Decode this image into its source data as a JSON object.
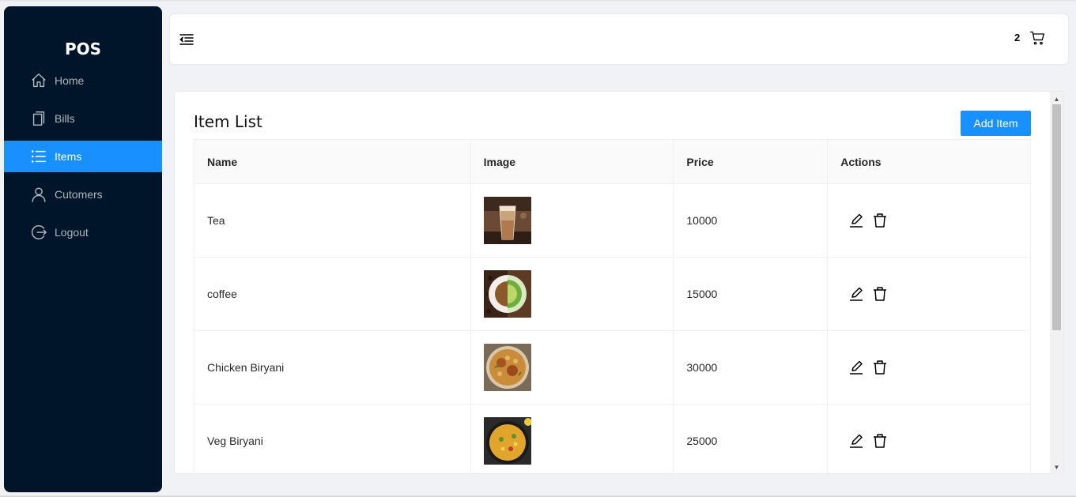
{
  "sidebar": {
    "logo": "POS",
    "items": [
      {
        "label": "Home",
        "icon": "home-icon",
        "active": false
      },
      {
        "label": "Bills",
        "icon": "copy-icon",
        "active": false
      },
      {
        "label": "Items",
        "icon": "unordered-list-icon",
        "active": true
      },
      {
        "label": "Cutomers",
        "icon": "user-icon",
        "active": false
      },
      {
        "label": "Logout",
        "icon": "logout-icon",
        "active": false
      }
    ]
  },
  "header": {
    "toggle_icon": "menu-fold-icon",
    "cart_count": "2",
    "cart_icon": "shopping-cart-icon"
  },
  "main": {
    "title": "Item List",
    "add_button_label": "Add Item",
    "columns": [
      "Name",
      "Image",
      "Price",
      "Actions"
    ],
    "rows": [
      {
        "name": "Tea",
        "image": "tea-image",
        "price": "10000"
      },
      {
        "name": "coffee",
        "image": "coffee-image",
        "price": "15000"
      },
      {
        "name": "Chicken Biryani",
        "image": "chicken-biryani-image",
        "price": "30000"
      },
      {
        "name": "Veg Biryani",
        "image": "veg-biryani-image",
        "price": "25000"
      }
    ],
    "action_icons": [
      "edit-icon",
      "delete-icon"
    ]
  },
  "colors": {
    "sidebar_bg": "#001529",
    "accent": "#1890ff",
    "page_bg": "#f0f2f5"
  }
}
